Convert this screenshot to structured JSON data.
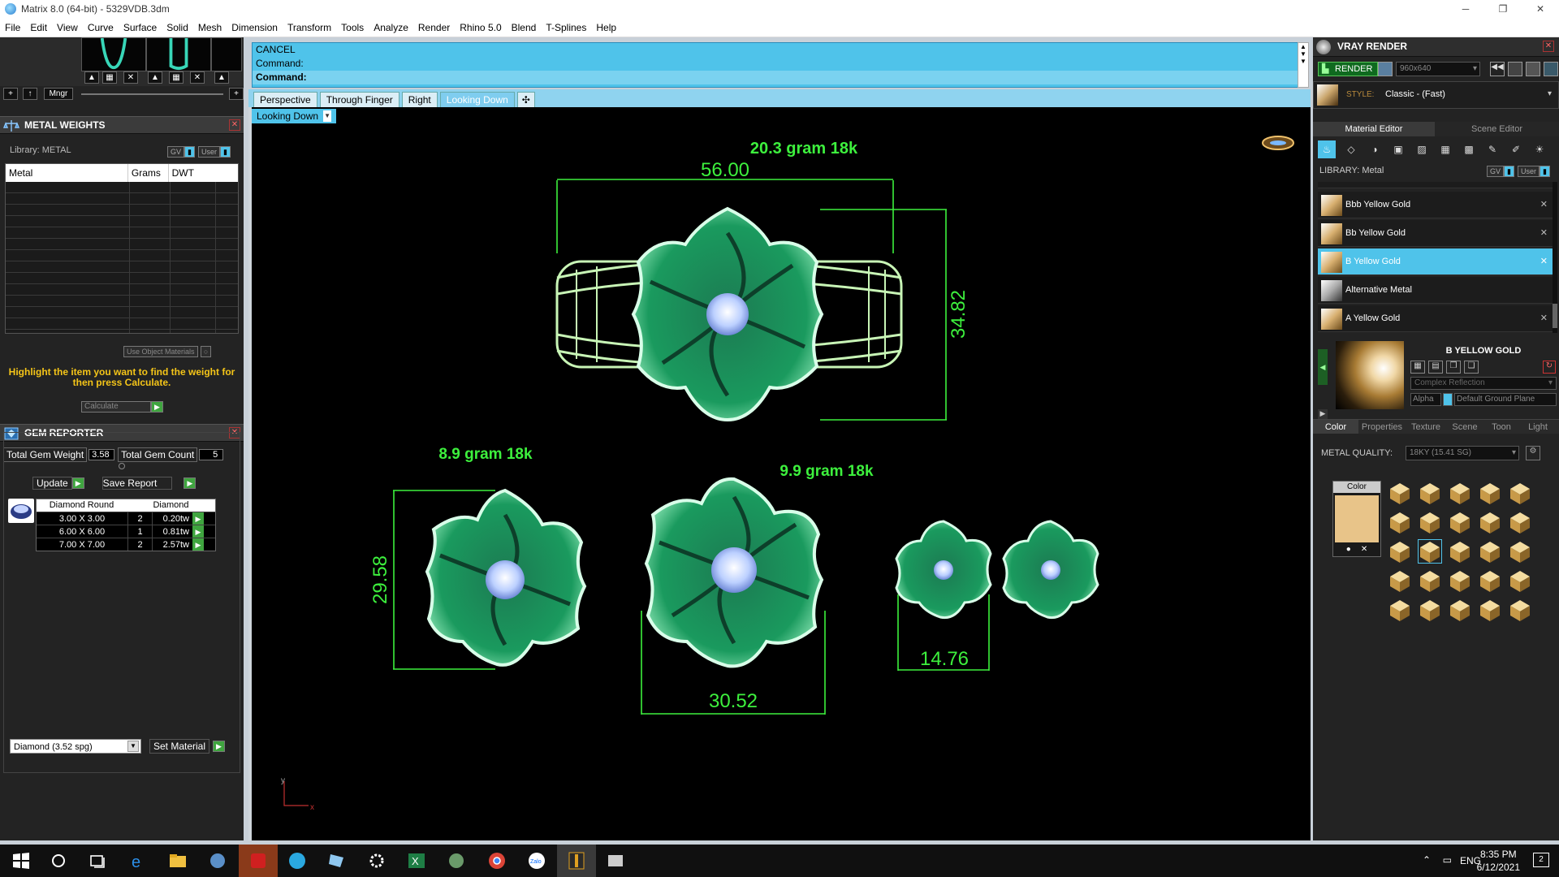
{
  "window": {
    "title": "Matrix 8.0 (64-bit) - 5329VDB.3dm",
    "controls": [
      "─",
      "❐",
      "✕"
    ]
  },
  "menu": [
    "File",
    "Edit",
    "View",
    "Curve",
    "Surface",
    "Solid",
    "Mesh",
    "Dimension",
    "Transform",
    "Tools",
    "Analyze",
    "Render",
    "Rhino 5.0",
    "Blend",
    "T-Splines",
    "Help"
  ],
  "thumbs": {
    "mngr_label": "Mngr"
  },
  "metal_weights": {
    "title": "METAL WEIGHTS",
    "library_label": "Library: METAL",
    "gv_label": "GV",
    "user_label": "User",
    "columns": [
      "Metal",
      "Grams",
      "DWT"
    ],
    "use_object_materials": "Use Object Materials",
    "hint": "Highlight the item you want to find the weight for then press Calculate.",
    "calculate": "Calculate"
  },
  "gem_reporter": {
    "title": "GEM REPORTER",
    "total_gem_weight_label": "Total Gem Weight",
    "total_gem_weight": "3.58",
    "total_gem_count_label": "Total Gem Count",
    "total_gem_count": "5",
    "update": "Update",
    "save_report": "Save Report",
    "columns": [
      "Diamond Round",
      "Diamond"
    ],
    "rows": [
      {
        "size": "3.00 X 3.00",
        "count": "2",
        "tw": "0.20tw"
      },
      {
        "size": "6.00 X 6.00",
        "count": "1",
        "tw": "0.81tw"
      },
      {
        "size": "7.00 X 7.00",
        "count": "2",
        "tw": "2.57tw"
      }
    ],
    "material_select": "Diamond     (3.52 spg)",
    "set_material": "Set Material"
  },
  "command": {
    "line1": "CANCEL",
    "line2": "Command:",
    "prompt": "Command:"
  },
  "view_tabs": [
    "Perspective",
    "Through Finger",
    "Right",
    "Looking Down"
  ],
  "active_view": "Looking Down",
  "viewport": {
    "label": "Looking Down",
    "weights": {
      "ring": "20.3 gram 18k",
      "earring": "8.9 gram 18k",
      "pendant": "9.9 gram 18k"
    },
    "dims": {
      "ring_width": "56.00",
      "ring_height": "34.82",
      "earring_height": "29.58",
      "pendant_width": "30.52",
      "stud_width": "14.76"
    },
    "axis_y": "y",
    "axis_x": "x"
  },
  "vray": {
    "title": "VRAY RENDER",
    "render": "RENDER",
    "resolution": "960x640",
    "style_label": "STYLE:",
    "style_value": "Classic - (Fast)",
    "tabs": [
      "Material Editor",
      "Scene Editor"
    ],
    "library_label": "LIBRARY: Metal",
    "gv_label": "GV",
    "user_label": "User",
    "materials": [
      "Bbb Yellow Gold",
      "Bb Yellow Gold",
      "B Yellow Gold",
      "Alternative Metal",
      "A Yellow Gold"
    ],
    "selected_material": "B YELLOW GOLD",
    "reflection": "Complex Reflection",
    "alpha_label": "Alpha",
    "ground_plane": "Default Ground Plane",
    "prop_tabs": [
      "Color",
      "Properties",
      "Texture",
      "Scene",
      "Toon",
      "Light"
    ],
    "metal_quality_label": "METAL QUALITY:",
    "metal_quality": "18KY       (15.41 SG)",
    "color_label": "Color",
    "swatch_color": "#e8c489"
  },
  "taskbar": {
    "lang": "ENG",
    "time": "8:35 PM",
    "date": "6/12/2021",
    "notifications": "2"
  }
}
